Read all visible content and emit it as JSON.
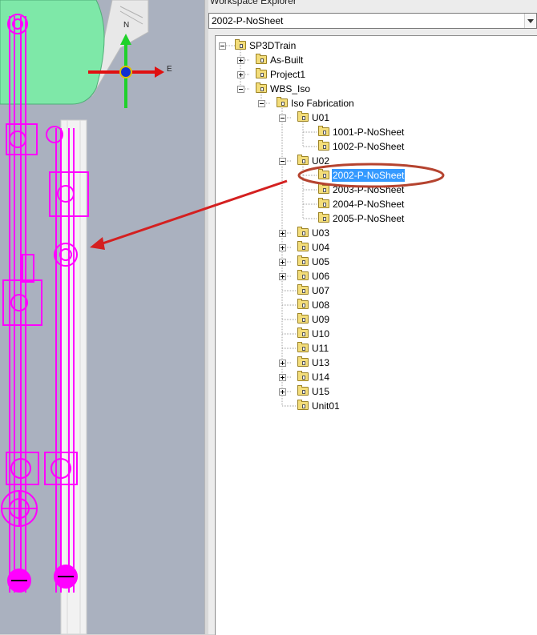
{
  "explorer": {
    "title": "Workspace Explorer",
    "workspace_select": {
      "value": "2002-P-NoSheet"
    }
  },
  "compass": {
    "north": "N",
    "east": "E"
  },
  "tree": {
    "root": {
      "label": "SP3DTrain",
      "expanded": true
    },
    "as_built": {
      "label": "As-Built",
      "expanded": false
    },
    "project1": {
      "label": "Project1",
      "expanded": false
    },
    "wbs_iso": {
      "label": "WBS_Iso",
      "expanded": true
    },
    "iso_fabrication": {
      "label": "Iso Fabrication",
      "expanded": true
    },
    "u01": {
      "label": "U01",
      "expanded": true,
      "children": [
        "1001-P-NoSheet",
        "1002-P-NoSheet"
      ]
    },
    "u02": {
      "label": "U02",
      "expanded": true,
      "children": [
        "2002-P-NoSheet",
        "2003-P-NoSheet",
        "2004-P-NoSheet",
        "2005-P-NoSheet"
      ],
      "selected": "2002-P-NoSheet"
    },
    "units": [
      {
        "label": "U03",
        "expandable": true
      },
      {
        "label": "U04",
        "expandable": true
      },
      {
        "label": "U05",
        "expandable": true
      },
      {
        "label": "U06",
        "expandable": true
      },
      {
        "label": "U07",
        "expandable": false
      },
      {
        "label": "U08",
        "expandable": false
      },
      {
        "label": "U09",
        "expandable": false
      },
      {
        "label": "U10",
        "expandable": false
      },
      {
        "label": "U11",
        "expandable": false
      },
      {
        "label": "U13",
        "expandable": true
      },
      {
        "label": "U14",
        "expandable": true
      },
      {
        "label": "U15",
        "expandable": true
      },
      {
        "label": "Unit01",
        "expandable": false
      }
    ]
  },
  "colors": {
    "piping": "#ff00ff",
    "vessel": "#7ee8a8",
    "selection": "#3399ff",
    "annotation": "#d42020"
  },
  "icons": [
    "folder-icon",
    "expand-icon",
    "collapse-icon",
    "compass-icon"
  ]
}
